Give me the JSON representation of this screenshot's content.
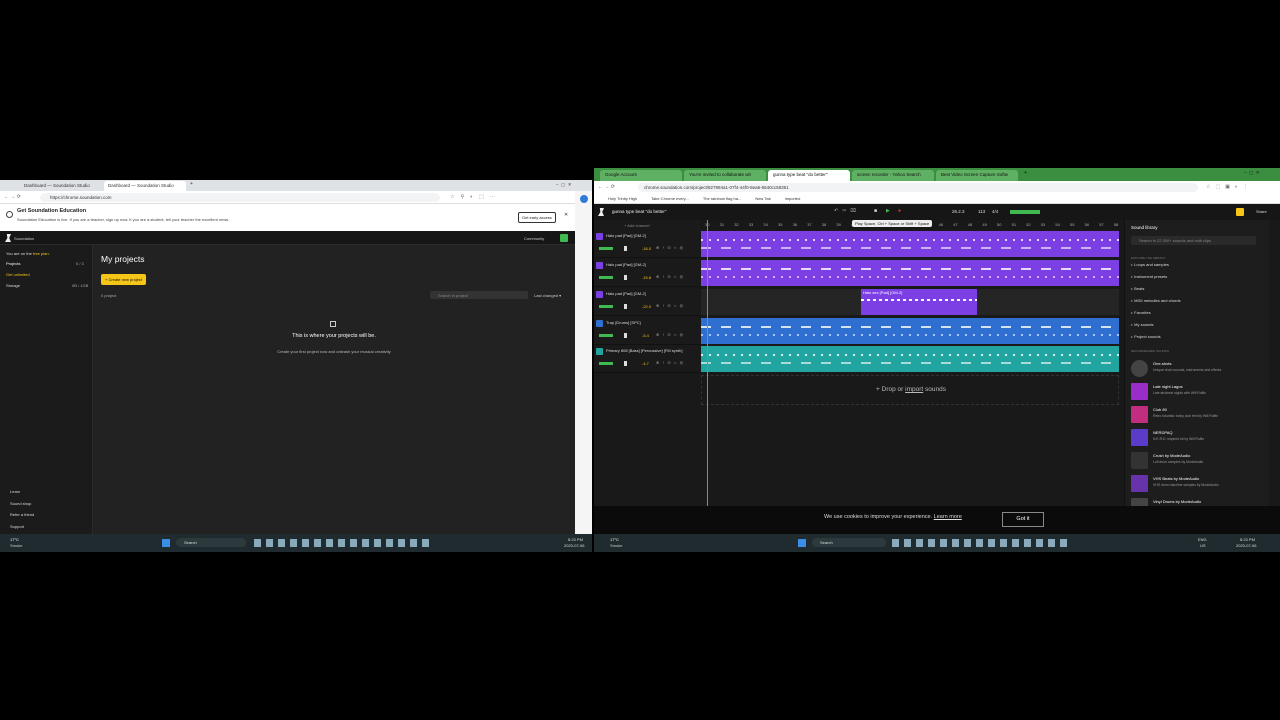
{
  "left_window": {
    "tabs": [
      "Dashboard — Soundation Studio",
      "Dashboard — Soundation Studio"
    ],
    "url": "https://chrome.soundation.com",
    "banner": {
      "title": "Get Soundation Education",
      "text": "Soundation Education is live. If you are a teacher, sign up now. If you are a student, tell your teacher the excellent news.",
      "button": "Get early access"
    },
    "header": {
      "community": "Community"
    },
    "sidebar": {
      "plan_prefix": "You are on the",
      "plan_link": "free plan.",
      "projects_label": "Projects",
      "projects_count": "0 / 3",
      "unlimited": "Get unlimited",
      "storage_label": "Storage",
      "storage_value": "0B / 1GB",
      "bottom": [
        "Learn",
        "Sound shop",
        "Refer a friend",
        "Support"
      ]
    },
    "main": {
      "title": "My projects",
      "create_button": "Create new project",
      "project_count": "0 project",
      "search_placeholder": "Search in project",
      "sort": "Last changed",
      "empty_title": "This is where your projects will be.",
      "empty_text": "Create your first project now and unleash your musical creativity"
    },
    "taskbar": {
      "temp": "17°C",
      "weather": "Smoke",
      "search": "Search",
      "time": "8:23 PM",
      "date": "2023-07-06"
    }
  },
  "right_window": {
    "tabs": [
      "Google Account",
      "You're invited to collaborate wit",
      "gunna type beat \"do better\"",
      "screen recorder - Yahoo Search",
      "Best Video Screen Capture Softw"
    ],
    "url": "chrome.soundation.com/project/827994a1-07f4-44f0-8ea6-5540cc58351",
    "bookmarks": [
      "Holy Trinity High",
      "Take Chrome every...",
      "The rainbow flag ha...",
      "New Tab",
      "imported"
    ],
    "project_title": "gunna type beat \"do better\"",
    "position": "26.2.3",
    "tempo": "113",
    "time_sig": "4/4",
    "share": "Share",
    "tooltip": "Play   Space, Ctrl + Space or Shift + Space",
    "add_channel": "Add channel",
    "ruler": [
      "30",
      "31",
      "32",
      "33",
      "34",
      "35",
      "36",
      "37",
      "38",
      "39",
      "40",
      "41",
      "42",
      "43",
      "44",
      "45",
      "46",
      "47",
      "48",
      "49",
      "50",
      "51",
      "52",
      "53",
      "54",
      "55",
      "56",
      "57",
      "58"
    ],
    "tracks": [
      {
        "name": "Halo pad [Pad] [GM-2]",
        "vol": "-16.0",
        "color": "#7b3fe4"
      },
      {
        "name": "Halo pad [Pad] [GM-2]",
        "vol": "-15.8",
        "color": "#7b3fe4"
      },
      {
        "name": "Halo pad [Pad] [GM-2]",
        "vol": "-22.0",
        "color": "#7b3fe4"
      },
      {
        "name": "Trap [Drums] [SPC]",
        "vol": "-5.4",
        "color": "#2f6fd0"
      },
      {
        "name": "Primary 808 [Bass] [Percussive] [FM synth]",
        "vol": "-4.7",
        "color": "#22a5a0"
      }
    ],
    "clip_label": "Halo sex [Pad] [GM-2]",
    "drop_text_prefix": "+ Drop or",
    "drop_link": "import",
    "drop_text_suffix": "sounds",
    "library": {
      "title": "Sound library",
      "search_placeholder": "Search in 22 000+ sounds and midi clips",
      "section": "EXPLORE THE LIBRARY",
      "menu": [
        "Loops and samples",
        "Instrument presets",
        "Beats",
        "MIDI melodies and chords",
        "Favorites",
        "My sounds",
        "Project sounds"
      ],
      "rec_section": "RECOMMENDED SOUNDS",
      "packs": [
        {
          "name": "One-shots",
          "desc": "Unique drum sounds, instruments and effects"
        },
        {
          "name": "Late night Lagos",
          "desc": "Late afrobeat nights with Will Ruffin"
        },
        {
          "name": "Club 80",
          "desc": "Retro futuristic funky club feel by Will Ruffin"
        },
        {
          "name": "NERDPAQ",
          "desc": "N.E.R.D. inspired kit by Will Ruffin"
        },
        {
          "name": "Crush by ModeAudio",
          "desc": "Lofi drum samples by ModeAudio"
        },
        {
          "name": "VHS Beats by ModeAudio",
          "desc": "VHS drum machine samples by ModeAudio"
        },
        {
          "name": "Vinyl Drums by ModeAudio",
          "desc": ""
        }
      ]
    },
    "cookie": {
      "text": "We use cookies to improve your experience.",
      "link": "Learn more",
      "button": "Got it"
    },
    "taskbar": {
      "temp": "17°C",
      "weather": "Smoke",
      "search": "Search",
      "lang": "ENG",
      "region": "US",
      "time": "8:23 PM",
      "date": "2023-07-06"
    }
  },
  "colors": {
    "purple": "#7b3fe4",
    "blue": "#2f6fd0",
    "teal": "#22a5a0",
    "yellow": "#f5c518",
    "green": "#3fb950"
  }
}
